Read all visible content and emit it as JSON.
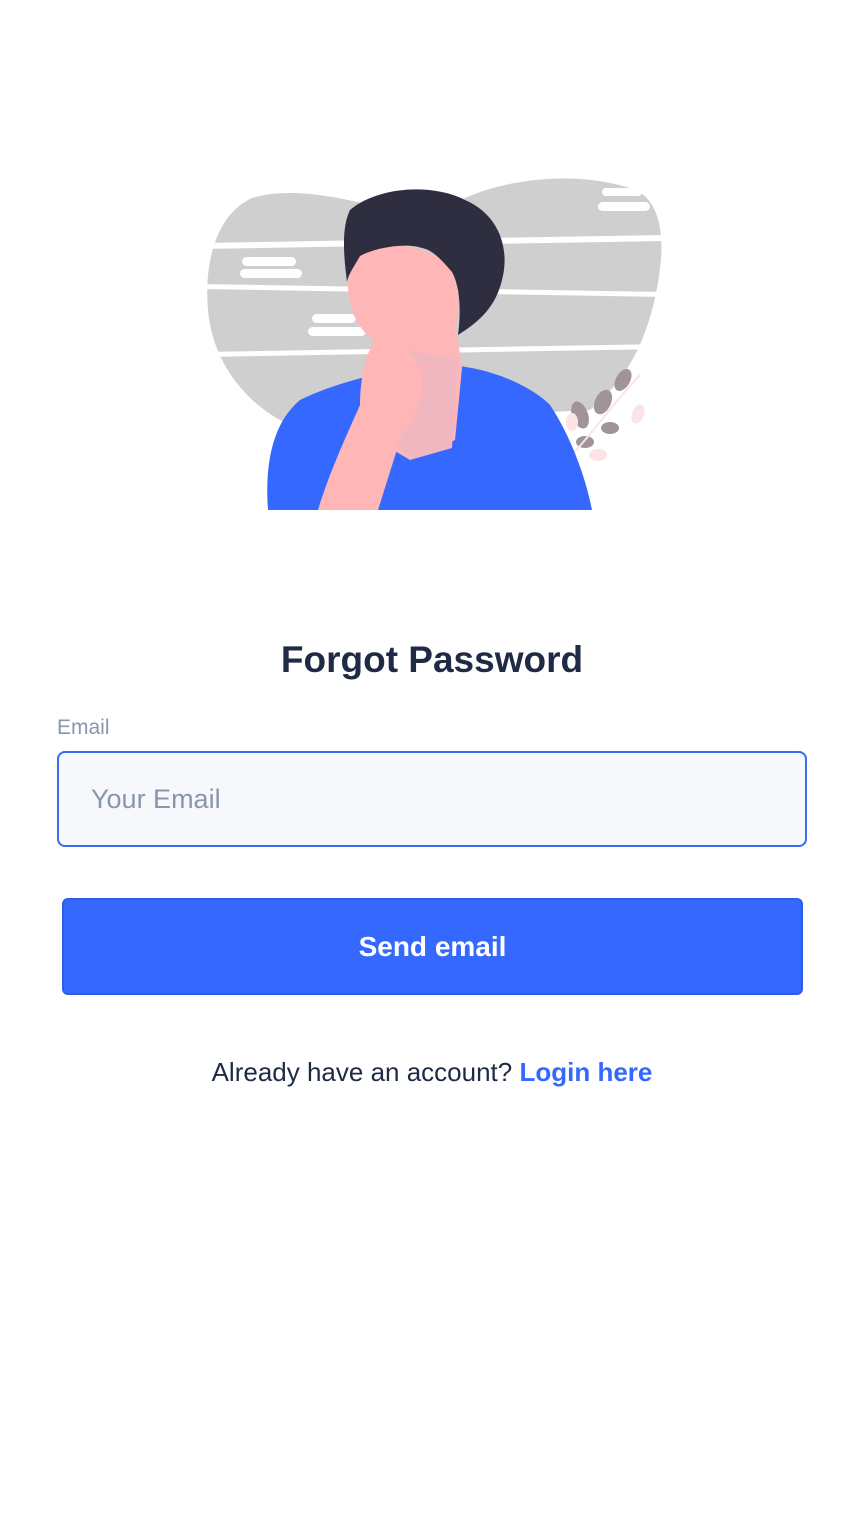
{
  "illustration": {
    "icon": "person-thinking-illustration",
    "colors": {
      "blob": "#cfcfcf",
      "hair": "#2f2e41",
      "skin": "#ffb6b6",
      "shirt": "#3568ff",
      "plant": "#a0939a"
    }
  },
  "page": {
    "title": "Forgot Password"
  },
  "form": {
    "email_label": "Email",
    "email_value": "",
    "email_placeholder": "Your Email",
    "submit_label": "Send email"
  },
  "footer": {
    "prompt": "Already have an account?",
    "link_label": "Login here"
  },
  "colors": {
    "accent": "#3568ff",
    "text": "#1f2a44",
    "muted": "#8a96ad",
    "input_bg": "#f6f8fc"
  }
}
